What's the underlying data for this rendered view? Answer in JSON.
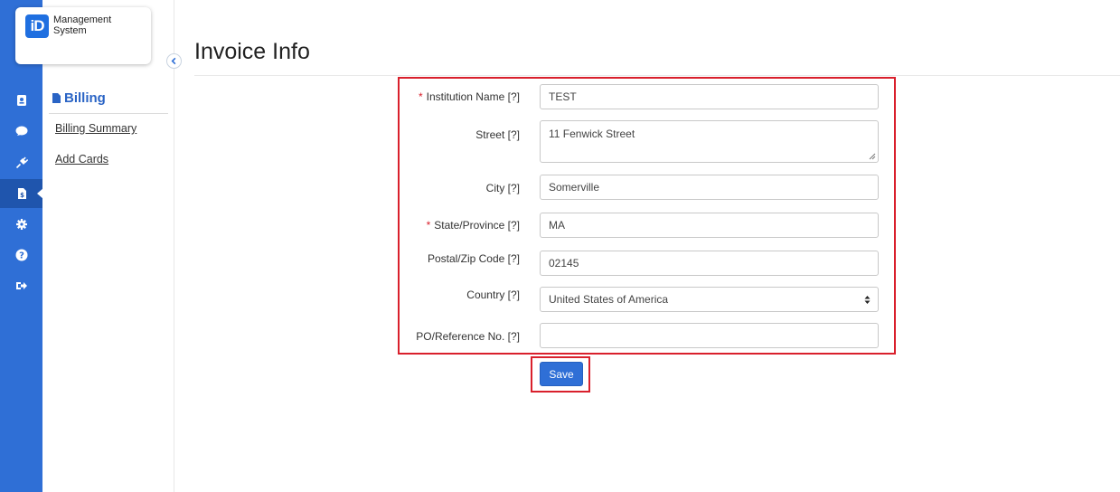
{
  "app": {
    "logo_mark": "iD",
    "logo_line1": "Management",
    "logo_line2": "System",
    "accent_color": "#2f6fd6",
    "highlight_color": "#d9202c"
  },
  "rail": {
    "icons": [
      "contact-card-icon",
      "chat-bubble-icon",
      "plug-icon",
      "invoice-icon",
      "gear-icon",
      "help-icon",
      "sign-out-icon"
    ],
    "active": "invoice-icon"
  },
  "subnav": {
    "heading": "Billing",
    "links": [
      "Billing Summary",
      "Add Cards"
    ]
  },
  "page": {
    "title": "Invoice Info"
  },
  "form": {
    "institution": {
      "label": "Institution Name [?]",
      "required": true,
      "value": "TEST"
    },
    "street": {
      "label": "Street [?]",
      "required": false,
      "value": "11 Fenwick Street"
    },
    "city": {
      "label": "City [?]",
      "required": false,
      "value": "Somerville"
    },
    "state": {
      "label": "State/Province [?]",
      "required": true,
      "value": "MA"
    },
    "postal": {
      "label": "Postal/Zip Code [?]",
      "required": false,
      "value": "02145"
    },
    "country": {
      "label": "Country [?]",
      "required": false,
      "value": "United States of America"
    },
    "po": {
      "label": "PO/Reference No. [?]",
      "required": false,
      "value": ""
    },
    "required_mark": "*",
    "save_label": "Save"
  }
}
